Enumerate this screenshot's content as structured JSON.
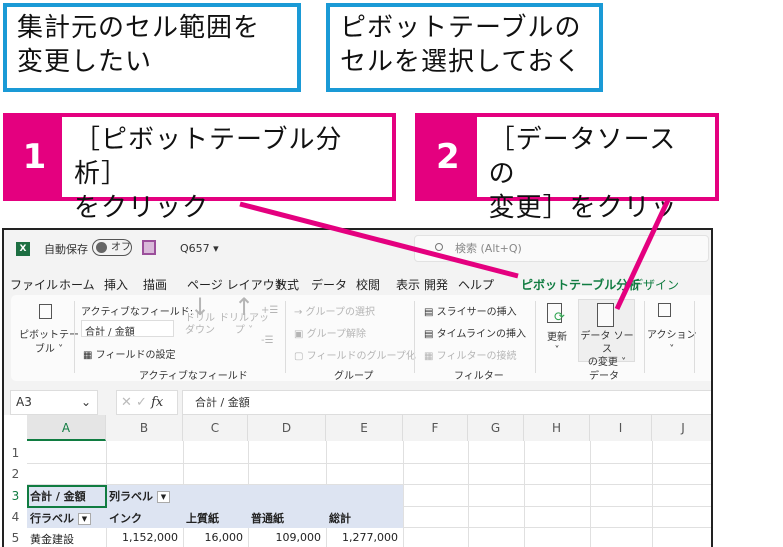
{
  "callouts": {
    "note1": "集計元のセル範囲を\n変更したい",
    "note2": "ピボットテーブルの\nセルを選択しておく",
    "step1": {
      "number": "1",
      "text": "［ピボットテーブル分析］\nをクリック"
    },
    "step2": {
      "number": "2",
      "text": "［データソースの\n変更］をクリック"
    },
    "accent": "#e4007f",
    "note_border": "#1a9ad6"
  },
  "titlebar": {
    "autosave_label": "自動保存",
    "autosave_state": "オフ",
    "filename": "Q657 ▾",
    "search_placeholder": "検索 (Alt+Q)"
  },
  "tabs": [
    "ファイル",
    "ホーム",
    "挿入",
    "描画",
    "ページ レイアウト",
    "数式",
    "データ",
    "校閲",
    "表示",
    "開発",
    "ヘルプ",
    "ピボットテーブル分析",
    "デザイン"
  ],
  "active_tab": "ピボットテーブル分析",
  "ribbon": {
    "pivottable": "ピボットテー\nブル ˅",
    "active_field_label": "アクティブなフィールド:",
    "active_field_value": "合計 / 金額",
    "field_settings": "フィールドの設定",
    "drill_down": "ドリル\nダウン",
    "drill_up": "ドリルアッ\nプ ˅",
    "group_active_field": "アクティブなフィールド",
    "group_selection": "→ グループの選択",
    "ungroup": "グループ解除",
    "group_field": "フィールドのグループ化",
    "group_group": "グループ",
    "insert_slicer": "スライサーの挿入",
    "insert_timeline": "タイムラインの挿入",
    "filter_connections": "フィルターの接続",
    "group_filter": "フィルター",
    "refresh": "更新\n˅",
    "change_source": "データ ソース\nの変更 ˅",
    "group_data": "データ",
    "actions": "アクション\n˅"
  },
  "formula_bar": {
    "name_box": "A3",
    "formula": "合計 / 金額"
  },
  "columns": [
    "A",
    "B",
    "C",
    "D",
    "E",
    "F",
    "G",
    "H",
    "I",
    "J"
  ],
  "rows": [
    "1",
    "2",
    "3",
    "4",
    "5"
  ],
  "pivot": {
    "r3": [
      "合計 / 金額",
      "列ラベル"
    ],
    "r4": [
      "行ラベル",
      "インク",
      "上質紙",
      "普通紙",
      "総計"
    ],
    "r5": [
      "黄金建設",
      "1,152,000",
      "16,000",
      "109,000",
      "1,277,000"
    ]
  }
}
